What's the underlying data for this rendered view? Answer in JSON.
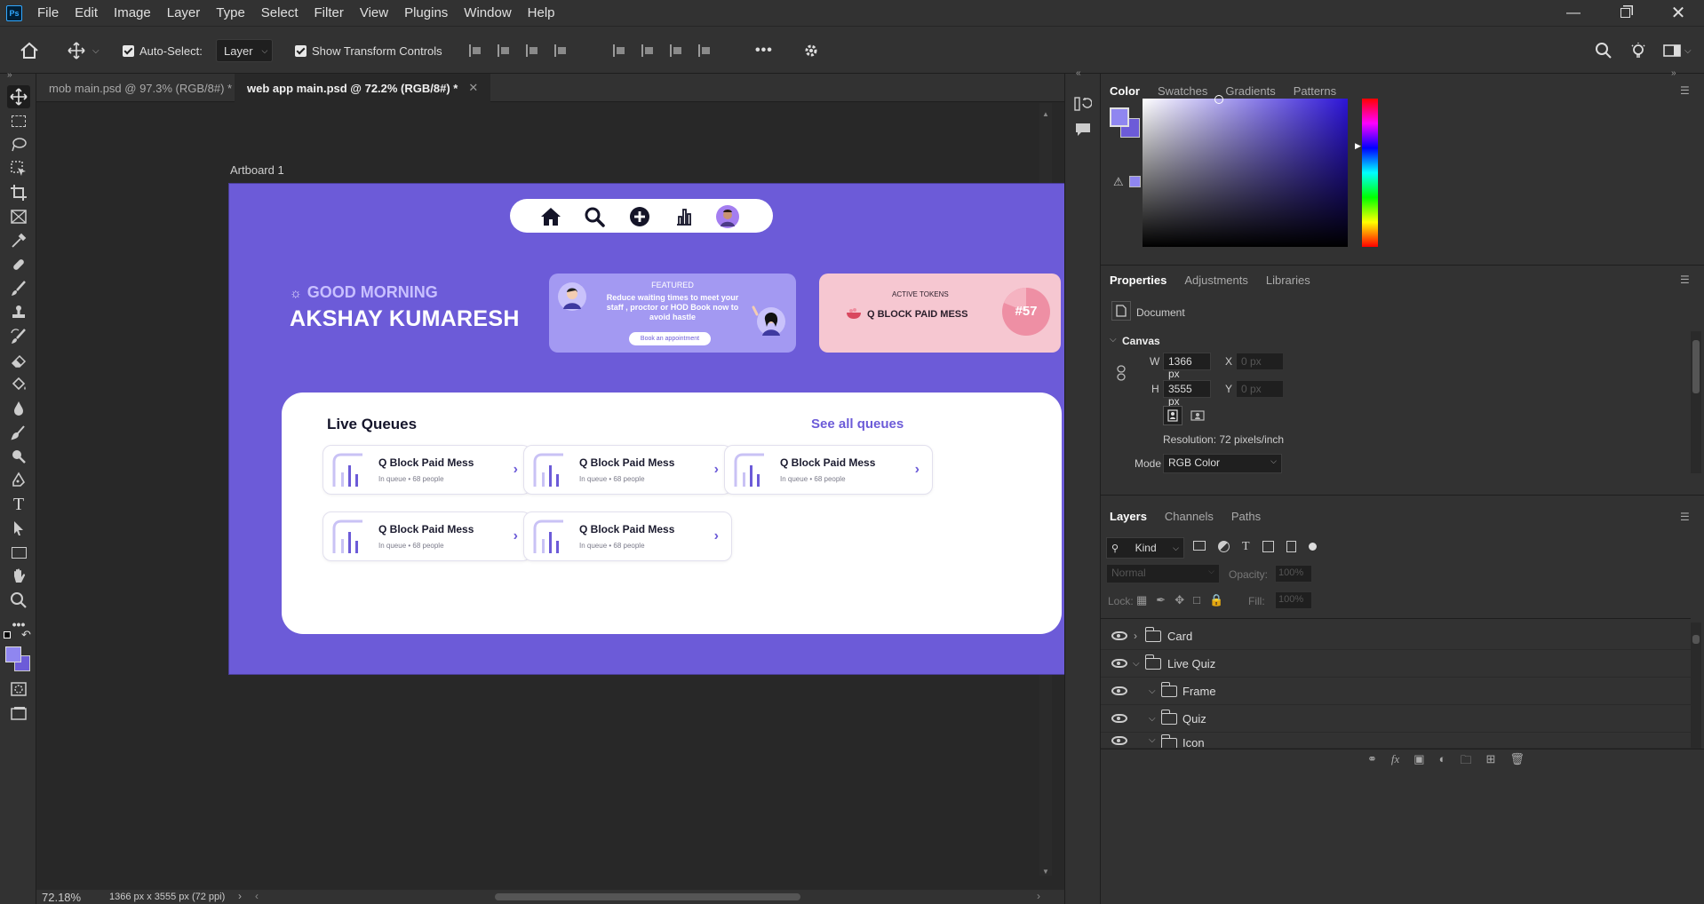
{
  "app": {
    "logo": "Ps",
    "menu": [
      "File",
      "Edit",
      "Image",
      "Layer",
      "Type",
      "Select",
      "Filter",
      "View",
      "Plugins",
      "Window",
      "Help"
    ],
    "window_controls": [
      "minimize-icon",
      "restore-icon",
      "close-icon"
    ]
  },
  "options_bar": {
    "auto_select_label": "Auto-Select:",
    "auto_select_checked": true,
    "auto_select_target": "Layer",
    "show_transform_label": "Show Transform Controls",
    "show_transform_checked": true,
    "more_label": "•••"
  },
  "tabs": [
    {
      "label": "mob main.psd @ 97.3% (RGB/8#) *",
      "active": false
    },
    {
      "label": "web app main.psd @ 72.2% (RGB/8#) *",
      "active": true
    }
  ],
  "artboard": {
    "label": "Artboard 1",
    "greeting": "GOOD MORNING",
    "user_name": "AKSHAY KUMARESH",
    "featured": {
      "tag": "FEATURED",
      "text": "Reduce waiting times to meet your staff , proctor or HOD Book now to avoid hastle",
      "button": "Book an appointment"
    },
    "tokens": {
      "tag": "ACTIVE TOKENS",
      "item": "Q BLOCK PAID MESS",
      "number": "#57"
    },
    "live": {
      "title": "Live Queues",
      "see_all": "See all queues",
      "queues": [
        {
          "title": "Q Block Paid Mess",
          "sub": "In queue • 68 people"
        },
        {
          "title": "Q Block Paid Mess",
          "sub": "In queue • 68 people"
        },
        {
          "title": "Q Block Paid Mess",
          "sub": "In queue • 68 people"
        },
        {
          "title": "Q Block Paid Mess",
          "sub": "In queue • 68 people"
        },
        {
          "title": "Q Block Paid Mess",
          "sub": "In queue • 68 people"
        }
      ]
    },
    "colors": {
      "bg": "#6c5bd8",
      "featured": "#a399f2",
      "tokens": "#f6c7d1",
      "token_badge": "#ee8fa4"
    }
  },
  "color_panel": {
    "tabs": [
      "Color",
      "Swatches",
      "Gradients",
      "Patterns"
    ],
    "foreground": "#8f86f0",
    "hue_color": "#2c14d6"
  },
  "properties_panel": {
    "tabs": [
      "Properties",
      "Adjustments",
      "Libraries"
    ],
    "doc_label": "Document",
    "section": "Canvas",
    "w_label": "W",
    "w_value": "1366 px",
    "h_label": "H",
    "h_value": "3555 px",
    "x_label": "X",
    "x_placeholder": "0 px",
    "y_label": "Y",
    "y_placeholder": "0 px",
    "resolution": "Resolution: 72 pixels/inch",
    "mode_label": "Mode",
    "mode_value": "RGB Color"
  },
  "layers_panel": {
    "tabs": [
      "Layers",
      "Channels",
      "Paths"
    ],
    "kind_label": "Kind",
    "blend_mode": "Normal",
    "opacity_label": "Opacity:",
    "opacity_value": "100%",
    "lock_label": "Lock:",
    "fill_label": "Fill:",
    "fill_value": "100%",
    "layers": [
      {
        "name": "Card",
        "expanded": false,
        "indent": 0
      },
      {
        "name": "Live Quiz",
        "expanded": true,
        "indent": 0
      },
      {
        "name": "Frame",
        "expanded": true,
        "indent": 1
      },
      {
        "name": "Quiz",
        "expanded": true,
        "indent": 1
      },
      {
        "name": "Icon",
        "expanded": true,
        "indent": 1
      }
    ]
  },
  "status": {
    "zoom": "72.18%",
    "doc_size": "1366 px x 3555 px (72 ppi)"
  }
}
